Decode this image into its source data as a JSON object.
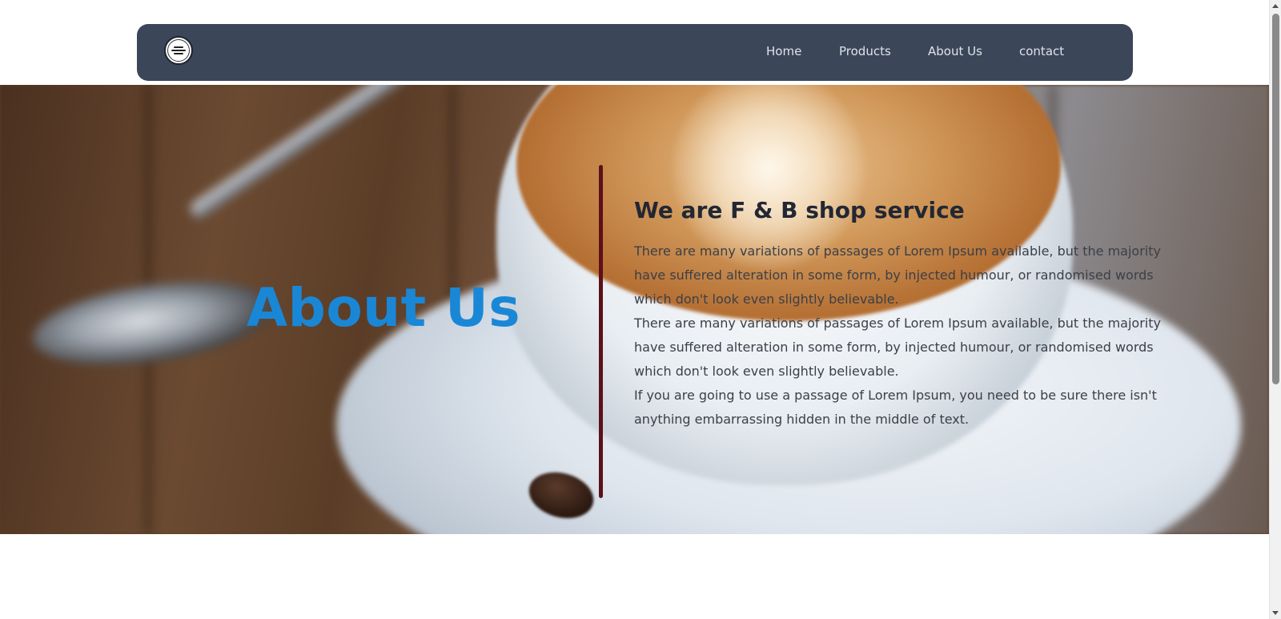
{
  "nav": {
    "logo_icon": "shop-logo-icon",
    "links": [
      "Home",
      "Products",
      "About Us",
      "contact"
    ]
  },
  "hero": {
    "title": "About Us",
    "heading": "We are F & B shop service",
    "paragraphs": [
      "There are many variations of passages of Lorem Ipsum available, but the majority have suffered alteration in some form, by injected humour, or randomised words which don't look even slightly believable.",
      "There are many variations of passages of Lorem Ipsum available, but the majority have suffered alteration in some form, by injected humour, or randomised words which don't look even slightly believable.",
      "If you are going to use a passage of Lorem Ipsum, you need to be sure there isn't anything embarrassing hidden in the middle of text."
    ]
  },
  "colors": {
    "nav_background": "#3b4658",
    "title_blue": "#1a87d6",
    "divider": "#5c1019"
  }
}
